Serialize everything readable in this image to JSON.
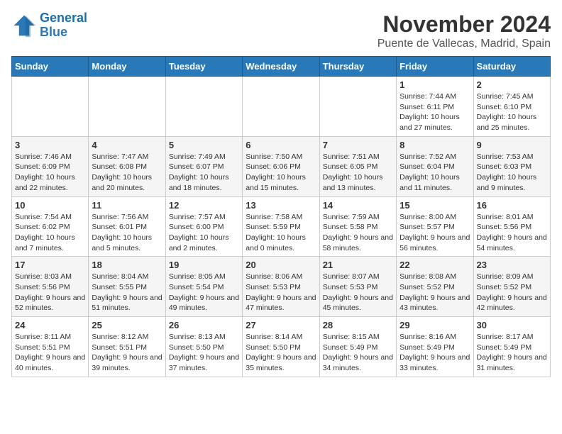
{
  "logo": {
    "line1": "General",
    "line2": "Blue"
  },
  "title": "November 2024",
  "subtitle": "Puente de Vallecas, Madrid, Spain",
  "weekdays": [
    "Sunday",
    "Monday",
    "Tuesday",
    "Wednesday",
    "Thursday",
    "Friday",
    "Saturday"
  ],
  "weeks": [
    [
      {
        "day": "",
        "info": ""
      },
      {
        "day": "",
        "info": ""
      },
      {
        "day": "",
        "info": ""
      },
      {
        "day": "",
        "info": ""
      },
      {
        "day": "",
        "info": ""
      },
      {
        "day": "1",
        "info": "Sunrise: 7:44 AM\nSunset: 6:11 PM\nDaylight: 10 hours and 27 minutes."
      },
      {
        "day": "2",
        "info": "Sunrise: 7:45 AM\nSunset: 6:10 PM\nDaylight: 10 hours and 25 minutes."
      }
    ],
    [
      {
        "day": "3",
        "info": "Sunrise: 7:46 AM\nSunset: 6:09 PM\nDaylight: 10 hours and 22 minutes."
      },
      {
        "day": "4",
        "info": "Sunrise: 7:47 AM\nSunset: 6:08 PM\nDaylight: 10 hours and 20 minutes."
      },
      {
        "day": "5",
        "info": "Sunrise: 7:49 AM\nSunset: 6:07 PM\nDaylight: 10 hours and 18 minutes."
      },
      {
        "day": "6",
        "info": "Sunrise: 7:50 AM\nSunset: 6:06 PM\nDaylight: 10 hours and 15 minutes."
      },
      {
        "day": "7",
        "info": "Sunrise: 7:51 AM\nSunset: 6:05 PM\nDaylight: 10 hours and 13 minutes."
      },
      {
        "day": "8",
        "info": "Sunrise: 7:52 AM\nSunset: 6:04 PM\nDaylight: 10 hours and 11 minutes."
      },
      {
        "day": "9",
        "info": "Sunrise: 7:53 AM\nSunset: 6:03 PM\nDaylight: 10 hours and 9 minutes."
      }
    ],
    [
      {
        "day": "10",
        "info": "Sunrise: 7:54 AM\nSunset: 6:02 PM\nDaylight: 10 hours and 7 minutes."
      },
      {
        "day": "11",
        "info": "Sunrise: 7:56 AM\nSunset: 6:01 PM\nDaylight: 10 hours and 5 minutes."
      },
      {
        "day": "12",
        "info": "Sunrise: 7:57 AM\nSunset: 6:00 PM\nDaylight: 10 hours and 2 minutes."
      },
      {
        "day": "13",
        "info": "Sunrise: 7:58 AM\nSunset: 5:59 PM\nDaylight: 10 hours and 0 minutes."
      },
      {
        "day": "14",
        "info": "Sunrise: 7:59 AM\nSunset: 5:58 PM\nDaylight: 9 hours and 58 minutes."
      },
      {
        "day": "15",
        "info": "Sunrise: 8:00 AM\nSunset: 5:57 PM\nDaylight: 9 hours and 56 minutes."
      },
      {
        "day": "16",
        "info": "Sunrise: 8:01 AM\nSunset: 5:56 PM\nDaylight: 9 hours and 54 minutes."
      }
    ],
    [
      {
        "day": "17",
        "info": "Sunrise: 8:03 AM\nSunset: 5:56 PM\nDaylight: 9 hours and 52 minutes."
      },
      {
        "day": "18",
        "info": "Sunrise: 8:04 AM\nSunset: 5:55 PM\nDaylight: 9 hours and 51 minutes."
      },
      {
        "day": "19",
        "info": "Sunrise: 8:05 AM\nSunset: 5:54 PM\nDaylight: 9 hours and 49 minutes."
      },
      {
        "day": "20",
        "info": "Sunrise: 8:06 AM\nSunset: 5:53 PM\nDaylight: 9 hours and 47 minutes."
      },
      {
        "day": "21",
        "info": "Sunrise: 8:07 AM\nSunset: 5:53 PM\nDaylight: 9 hours and 45 minutes."
      },
      {
        "day": "22",
        "info": "Sunrise: 8:08 AM\nSunset: 5:52 PM\nDaylight: 9 hours and 43 minutes."
      },
      {
        "day": "23",
        "info": "Sunrise: 8:09 AM\nSunset: 5:52 PM\nDaylight: 9 hours and 42 minutes."
      }
    ],
    [
      {
        "day": "24",
        "info": "Sunrise: 8:11 AM\nSunset: 5:51 PM\nDaylight: 9 hours and 40 minutes."
      },
      {
        "day": "25",
        "info": "Sunrise: 8:12 AM\nSunset: 5:51 PM\nDaylight: 9 hours and 39 minutes."
      },
      {
        "day": "26",
        "info": "Sunrise: 8:13 AM\nSunset: 5:50 PM\nDaylight: 9 hours and 37 minutes."
      },
      {
        "day": "27",
        "info": "Sunrise: 8:14 AM\nSunset: 5:50 PM\nDaylight: 9 hours and 35 minutes."
      },
      {
        "day": "28",
        "info": "Sunrise: 8:15 AM\nSunset: 5:49 PM\nDaylight: 9 hours and 34 minutes."
      },
      {
        "day": "29",
        "info": "Sunrise: 8:16 AM\nSunset: 5:49 PM\nDaylight: 9 hours and 33 minutes."
      },
      {
        "day": "30",
        "info": "Sunrise: 8:17 AM\nSunset: 5:49 PM\nDaylight: 9 hours and 31 minutes."
      }
    ]
  ]
}
